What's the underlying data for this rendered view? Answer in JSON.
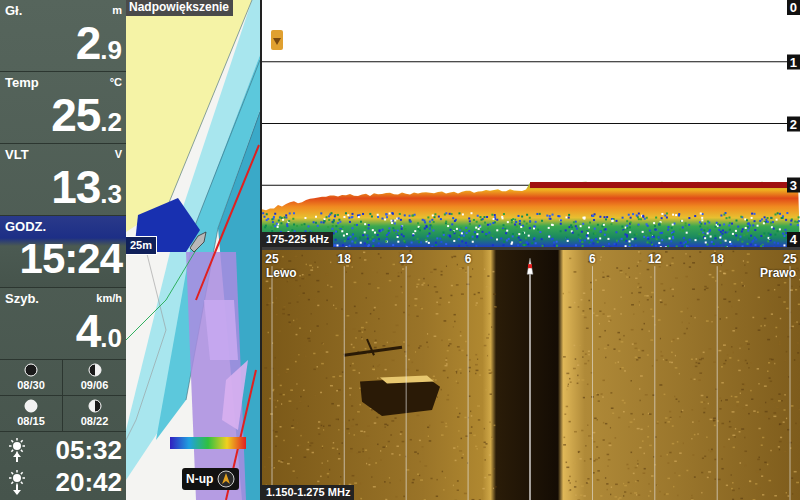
{
  "sidebar": {
    "readouts": [
      {
        "label": "Gł.",
        "unit": "m",
        "main": "2",
        "fraction": ".9"
      },
      {
        "label": "Temp",
        "unit": "°C",
        "main": "25",
        "fraction": ".2"
      },
      {
        "label": "VLT",
        "unit": "V",
        "main": "13",
        "fraction": ".3"
      },
      {
        "label": "GODZ.",
        "unit": "",
        "main": "15:24",
        "fraction": ""
      },
      {
        "label": "Szyb.",
        "unit": "km/h",
        "main": "4",
        "fraction": ".0"
      }
    ],
    "moon_phases": [
      {
        "date": "08/30",
        "phase": "new"
      },
      {
        "date": "09/06",
        "phase": "first-quarter"
      },
      {
        "date": "08/15",
        "phase": "full"
      },
      {
        "date": "08/22",
        "phase": "last-quarter"
      }
    ],
    "sun": [
      {
        "kind": "sunrise",
        "time": "05:32"
      },
      {
        "kind": "sunset",
        "time": "20:42"
      }
    ]
  },
  "map": {
    "title": "Nadpowiększenie",
    "range": "25m",
    "orientation": "N-up"
  },
  "sonar": {
    "depth_ticks": [
      "0",
      "1",
      "2",
      "3",
      "4"
    ],
    "frequency": "175-225 kHz"
  },
  "side_imaging": {
    "range_ticks_left": [
      "25",
      "18",
      "12",
      "6"
    ],
    "range_ticks_right": [
      "6",
      "12",
      "18",
      "25"
    ],
    "left_label": "Lewo",
    "right_label": "Prawo",
    "frequency": "1.150-1.275 MHz"
  }
}
